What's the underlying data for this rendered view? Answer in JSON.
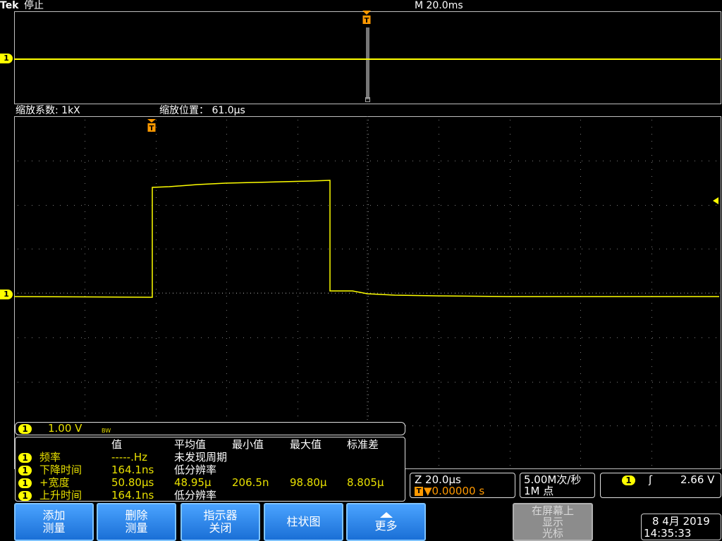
{
  "header": {
    "brand": "Tek",
    "state": "停止",
    "horizontal_scale": "M 20.0ms"
  },
  "zoom_bar": {
    "factor": "缩放系数: 1kX",
    "position": "缩放位置： 61.0µs"
  },
  "channel_marker": "1",
  "trigger_marker": "T",
  "channel_readout": {
    "badge": "1",
    "scale": "1.00 V",
    "bw": "BW"
  },
  "measurements": {
    "headers": [
      "值",
      "平均值",
      "最小值",
      "最大值",
      "标准差"
    ],
    "rows": [
      {
        "ch": "1",
        "name": "频率",
        "value": "-----.Hz",
        "mean": "未发现周期",
        "min": "",
        "max": "",
        "std": ""
      },
      {
        "ch": "1",
        "name": "下降时间",
        "value": "164.1ns",
        "mean": "低分辨率",
        "min": "",
        "max": "",
        "std": ""
      },
      {
        "ch": "1",
        "name": "+宽度",
        "value": "50.80µs",
        "mean": "48.95µ",
        "min": "206.5n",
        "max": "98.80µ",
        "std": "8.805µ"
      },
      {
        "ch": "1",
        "name": "上升时间",
        "value": "164.1ns",
        "mean": "低分辨率",
        "min": "",
        "max": "",
        "std": ""
      }
    ]
  },
  "zoom_readout": {
    "scale": "Z 20.0µs",
    "trigger_pos": "▼0.00000 s",
    "trigger_badge": "T"
  },
  "acquisition": {
    "rate": "5.00M次/秒",
    "points": "1M 点"
  },
  "trigger_readout": {
    "badge": "1",
    "slope": "ʃ",
    "level": "2.66 V"
  },
  "softkeys": [
    {
      "line1": "添加",
      "line2": "测量"
    },
    {
      "line1": "删除",
      "line2": "测量"
    },
    {
      "line1": "指示器",
      "line2": "关闭"
    },
    {
      "line1": "柱状图",
      "line2": ""
    },
    {
      "line1": "更多",
      "line2": ""
    },
    {
      "line1": "在屏幕上",
      "line2": "显示",
      "line3": "光标"
    }
  ],
  "datetime": {
    "date": "8 4月 2019",
    "time": "14:35:33"
  },
  "colors": {
    "trace": "#ffff00",
    "trigger": "#ff9900",
    "softkey": "#2a86ec"
  }
}
